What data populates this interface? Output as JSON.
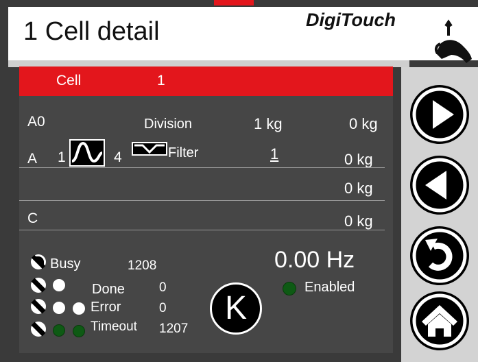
{
  "header": {
    "title": "1  Cell detail",
    "logo_text": "DigiTouch"
  },
  "cell_bar": {
    "label": "Cell",
    "number": "1"
  },
  "rows": {
    "a0": {
      "label": "A0",
      "division_label": "Division",
      "division_value": "1 kg",
      "weight": "0 kg"
    },
    "a": {
      "label": "A",
      "wave_left": "1",
      "wave_right": "4",
      "filter_label": "Filter",
      "filter_value": "1",
      "weight": "0 kg"
    },
    "blank": {
      "weight": "0 kg"
    },
    "c": {
      "label": "C",
      "weight": "0 kg"
    }
  },
  "status": {
    "busy": {
      "label": "Busy",
      "value": "1208"
    },
    "done": {
      "label": "Done",
      "value": "0"
    },
    "error": {
      "label": "Error",
      "value": "0"
    },
    "timeout": {
      "label": "Timeout",
      "value": "1207"
    }
  },
  "frequency": "0.00 Hz",
  "enabled_label": "Enabled",
  "k_button": "K",
  "colors": {
    "accent_red": "#e3161c",
    "panel": "#464646",
    "led_green": "#0e5a14"
  },
  "icons": [
    "play-next-icon",
    "play-prev-icon",
    "back-rotate-icon",
    "home-icon",
    "k-icon",
    "sine-wave-icon",
    "filter-wave-icon"
  ]
}
